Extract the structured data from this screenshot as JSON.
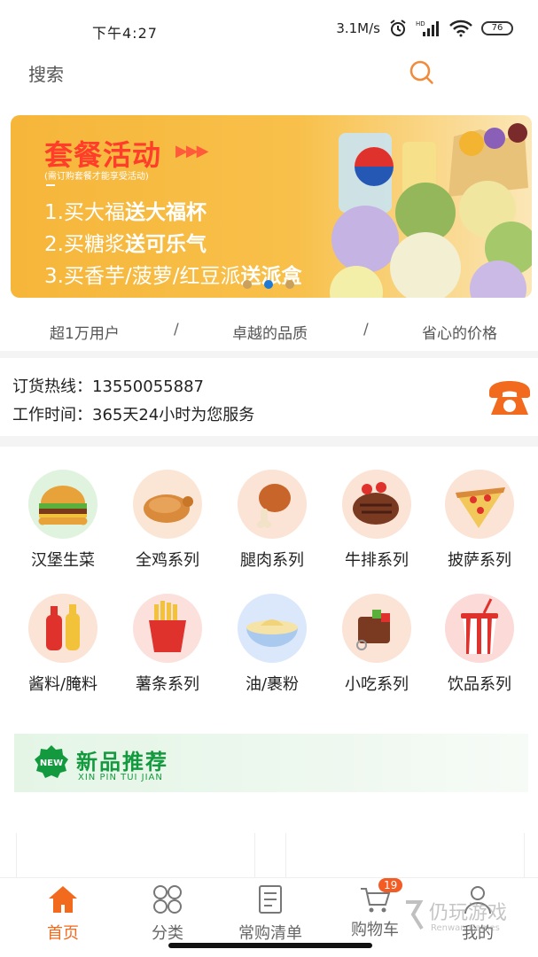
{
  "status": {
    "time": "下午4:27",
    "speed": "3.1M/s",
    "battery": "76",
    "hd": "HD"
  },
  "search": {
    "label": "搜索"
  },
  "banner": {
    "title": "套餐活动",
    "arrows": "▶▶▶",
    "note": "(需订购套餐才能享受活动)",
    "line1_a": "1.买大福",
    "line1_b": "送大福杯",
    "line2_a": "2.买糖浆",
    "line2_b": "送可乐气",
    "line3_a": "3.买香芋/菠萝/红豆派",
    "line3_b": "送派盒",
    "active_dot": 1,
    "dot_count": 3
  },
  "slogans": [
    "超1万用户",
    "卓越的品质",
    "省心的价格"
  ],
  "slash": "/",
  "hotline": {
    "phone_label": "订货热线：13550055887",
    "hours_label": "工作时间：365天24小时为您服务"
  },
  "categories": [
    {
      "label": "汉堡生菜",
      "icon": "burger-icon"
    },
    {
      "label": "全鸡系列",
      "icon": "roast-chicken-icon"
    },
    {
      "label": "腿肉系列",
      "icon": "chicken-leg-icon"
    },
    {
      "label": "牛排系列",
      "icon": "steak-icon"
    },
    {
      "label": "披萨系列",
      "icon": "pizza-icon"
    },
    {
      "label": "酱料/腌料",
      "icon": "sauce-bottles-icon"
    },
    {
      "label": "薯条系列",
      "icon": "fries-icon"
    },
    {
      "label": "油/裹粉",
      "icon": "batter-bowl-icon"
    },
    {
      "label": "小吃系列",
      "icon": "snack-skewer-icon"
    },
    {
      "label": "饮品系列",
      "icon": "drink-cup-icon"
    }
  ],
  "new_section": {
    "badge": "NEW",
    "title": "新品推荐",
    "subtitle": "XIN PIN TUI JIAN"
  },
  "tabs": [
    {
      "label": "首页",
      "icon": "home-icon",
      "active": true
    },
    {
      "label": "分类",
      "icon": "category-icon",
      "active": false
    },
    {
      "label": "常购清单",
      "icon": "list-icon",
      "active": false
    },
    {
      "label": "购物车",
      "icon": "cart-icon",
      "active": false,
      "badge": "19"
    },
    {
      "label": "我的",
      "icon": "user-icon",
      "active": false
    }
  ],
  "watermark": {
    "text": "仍玩游戏",
    "sub": "Renwan Games"
  },
  "colors": {
    "accent": "#f26a1d",
    "banner": "#f8c04a",
    "green": "#139a3e"
  }
}
